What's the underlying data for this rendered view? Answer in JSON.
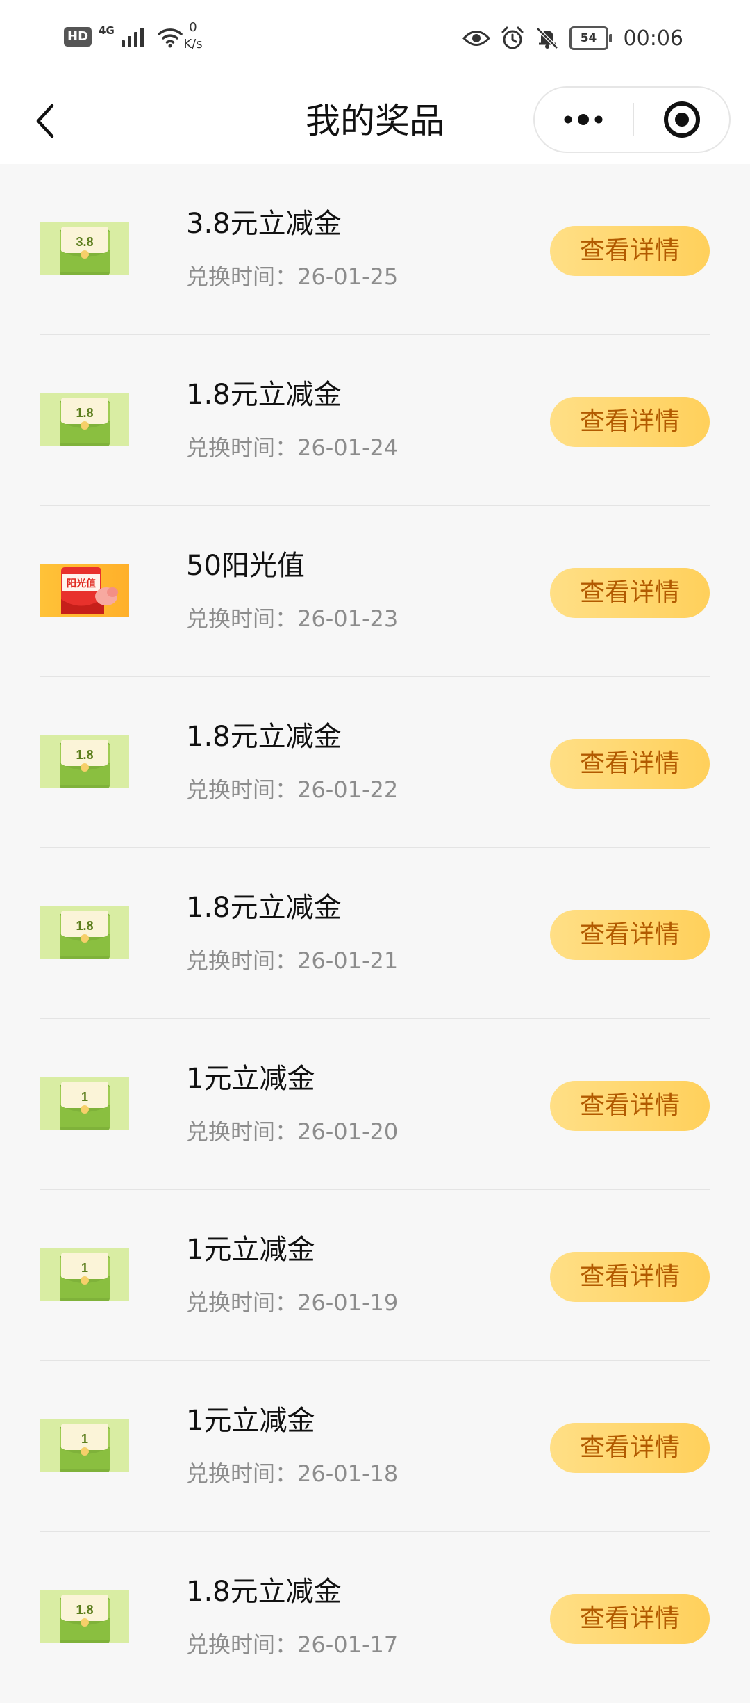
{
  "status_bar": {
    "hd": "HD",
    "network": "4G",
    "speed_value": "0",
    "speed_unit": "K/s",
    "battery": "54",
    "time": "00:06"
  },
  "nav": {
    "title": "我的奖品"
  },
  "prizes": [
    {
      "name": "3.8元立减金",
      "time": "兑换时间：26-01-25",
      "button": "查看详情",
      "icon": "coupon-3.8",
      "badge": "3.8"
    },
    {
      "name": "1.8元立减金",
      "time": "兑换时间：26-01-24",
      "button": "查看详情",
      "icon": "coupon-1.8",
      "badge": "1.8"
    },
    {
      "name": "50阳光值",
      "time": "兑换时间：26-01-23",
      "button": "查看详情",
      "icon": "sunshine-redpacket",
      "badge": "阳光值"
    },
    {
      "name": "1.8元立减金",
      "time": "兑换时间：26-01-22",
      "button": "查看详情",
      "icon": "coupon-1.8",
      "badge": "1.8"
    },
    {
      "name": "1.8元立减金",
      "time": "兑换时间：26-01-21",
      "button": "查看详情",
      "icon": "coupon-1.8",
      "badge": "1.8"
    },
    {
      "name": "1元立减金",
      "time": "兑换时间：26-01-20",
      "button": "查看详情",
      "icon": "coupon-1",
      "badge": "1"
    },
    {
      "name": "1元立减金",
      "time": "兑换时间：26-01-19",
      "button": "查看详情",
      "icon": "coupon-1",
      "badge": "1"
    },
    {
      "name": "1元立减金",
      "time": "兑换时间：26-01-18",
      "button": "查看详情",
      "icon": "coupon-1",
      "badge": "1"
    },
    {
      "name": "1.8元立减金",
      "time": "兑换时间：26-01-17",
      "button": "查看详情",
      "icon": "coupon-1.8",
      "badge": "1.8"
    }
  ],
  "colors": {
    "button_bg": "#ffd766",
    "button_text": "#b25a00",
    "coupon_green": "#8bbd3b",
    "coupon_bg": "#d6ec9e"
  }
}
